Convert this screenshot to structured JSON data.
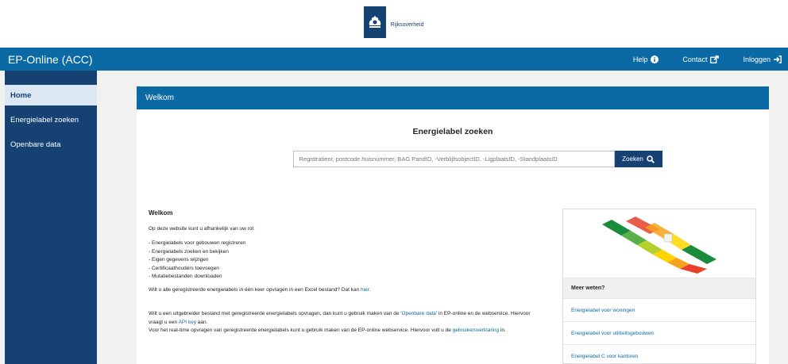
{
  "gov": {
    "name": "Rijksoverheid",
    "logo_icon": "rijksoverheid-lion-icon",
    "color": "#154273"
  },
  "topbar": {
    "title": "EP-Online (ACC)",
    "color": "#0b6aa3",
    "nav": [
      {
        "label": "Help",
        "icon": "info-circle-icon"
      },
      {
        "label": "Contact",
        "icon": "external-link-icon"
      },
      {
        "label": "Inloggen",
        "icon": "sign-in-icon"
      }
    ]
  },
  "sidebar": {
    "color": "#154273",
    "items": [
      {
        "label": "Home",
        "active": true
      },
      {
        "label": "Energielabel zoeken",
        "active": false
      },
      {
        "label": "Openbare data",
        "active": false
      }
    ]
  },
  "content": {
    "header": "Welkom",
    "search": {
      "title": "Energielabel zoeken",
      "placeholder": "Registratienr, postcode huisnummer, BAG PandID, -VerblijfsobjectID, -LigplaatsID, -StandplaatsID",
      "button_label": "Zoeken",
      "button_icon": "search-icon"
    },
    "intro": {
      "heading": "Welkom",
      "lead": "Op deze website kunt u afhankelijk van uw rol:",
      "bullets": [
        "Energielabels voor gebouwen registreren",
        "Energielabels zoeken en bekijken",
        "Eigen gegevens wijzigen",
        "Certificaathouders toevoegen",
        "Mutatiebestanden downloaden"
      ],
      "excel_text": "Wilt u alle geregistreerde energielabels in één keer opvragen in een Excel bestand? Dat kan ",
      "excel_link": "hier",
      "excel_end": ".",
      "p2_a": "Wilt u een uitgebreider bestand met geregistreerde energielabels opvragen, dan kunt u gebruik maken van de '",
      "p2_link1": "Openbare data",
      "p2_b": "' in EP-online en de webservice. Hiervoor vraagt u een ",
      "p2_link2": "API key",
      "p2_c": " aan.",
      "p3_a": "Voor het real-time opvragen van geregistreerde energielabels kunt u gebruik maken van de EP-online webservice. Hiervoor vult u de ",
      "p3_link": "gebruikersverklaring",
      "p3_b": " in."
    },
    "infobox": {
      "image_icon": "energielabel-illustration-icon",
      "title": "Meer weten?",
      "links": [
        "Energielabel voor woningen",
        "Energielabel voor utiliteitsgebouwen",
        "Energielabel C voor kantoren"
      ]
    }
  }
}
